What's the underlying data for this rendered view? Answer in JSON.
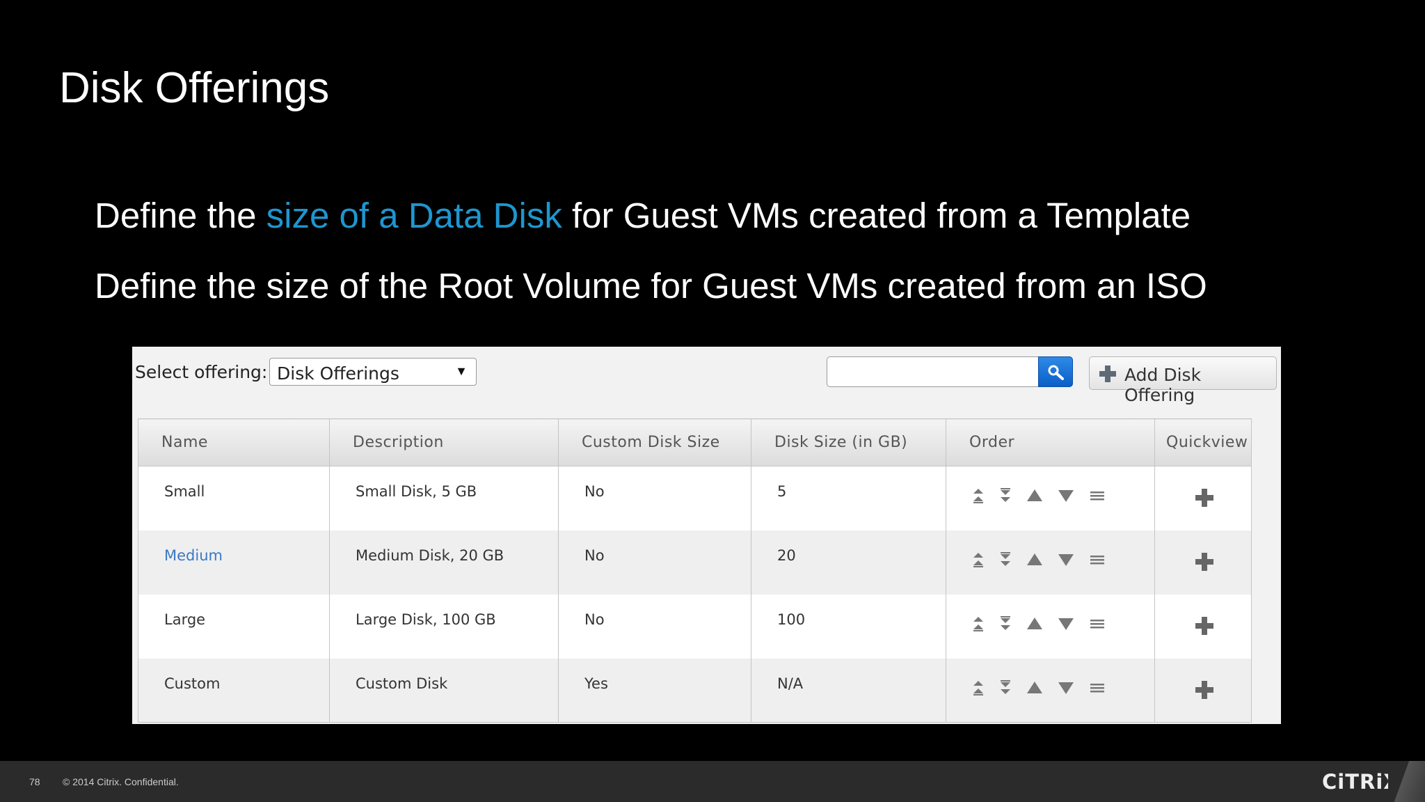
{
  "slide": {
    "title": "Disk Offerings",
    "bullets": [
      {
        "before": "Define the ",
        "highlight": "size of a Data Disk",
        "after": " for Guest VMs created from a Template"
      },
      {
        "text": "Define the size of the Root Volume for Guest VMs created from an ISO"
      }
    ],
    "accent_color": "#1e96cf"
  },
  "toolbar": {
    "select_label": "Select offering:",
    "select_value": "Disk Offerings",
    "search_value": "",
    "search_icon": "search-icon",
    "add_label": "Add Disk Offering"
  },
  "table": {
    "headers": [
      "Name",
      "Description",
      "Custom Disk Size",
      "Disk Size (in GB)",
      "Order",
      "Quickview"
    ],
    "rows": [
      {
        "name": "Small",
        "description": "Small Disk, 5 GB",
        "custom": "No",
        "size": "5"
      },
      {
        "name": "Medium",
        "description": "Medium Disk, 20 GB",
        "custom": "No",
        "size": "20"
      },
      {
        "name": "Large",
        "description": "Large Disk, 100 GB",
        "custom": "No",
        "size": "100"
      },
      {
        "name": "Custom",
        "description": "Custom Disk",
        "custom": "Yes",
        "size": "N/A"
      }
    ],
    "order_icons": [
      "move-top-icon",
      "move-bottom-icon",
      "move-up-icon",
      "move-down-icon",
      "drag-handle-icon"
    ],
    "quickview_icon": "plus-icon",
    "link_color": "#3b78c4"
  },
  "footer": {
    "page_number": "78",
    "copyright": "© 2014 Citrix. Confidential.",
    "logo": "CiTRiX"
  }
}
